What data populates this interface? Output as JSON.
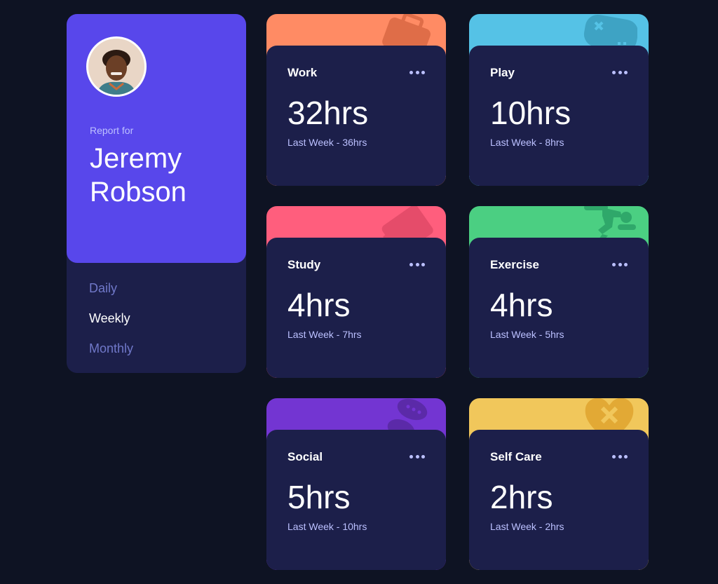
{
  "profile": {
    "report_for": "Report for",
    "name": "Jeremy Robson",
    "periods": [
      {
        "label": "Daily",
        "active": false
      },
      {
        "label": "Weekly",
        "active": true
      },
      {
        "label": "Monthly",
        "active": false
      }
    ]
  },
  "cards": [
    {
      "title": "Work",
      "hours": "32hrs",
      "previous": "Last Week - 36hrs",
      "color": "#ff8b64",
      "icon": "briefcase-icon"
    },
    {
      "title": "Play",
      "hours": "10hrs",
      "previous": "Last Week - 8hrs",
      "color": "#55c2e6",
      "icon": "gamepad-icon"
    },
    {
      "title": "Study",
      "hours": "4hrs",
      "previous": "Last Week - 7hrs",
      "color": "#ff5e7d",
      "icon": "book-icon"
    },
    {
      "title": "Exercise",
      "hours": "4hrs",
      "previous": "Last Week - 5hrs",
      "color": "#4bcf82",
      "icon": "running-icon"
    },
    {
      "title": "Social",
      "hours": "5hrs",
      "previous": "Last Week - 10hrs",
      "color": "#7335d2",
      "icon": "chat-icon"
    },
    {
      "title": "Self Care",
      "hours": "2hrs",
      "previous": "Last Week - 2hrs",
      "color": "#f1c75b",
      "icon": "heart-icon"
    }
  ]
}
